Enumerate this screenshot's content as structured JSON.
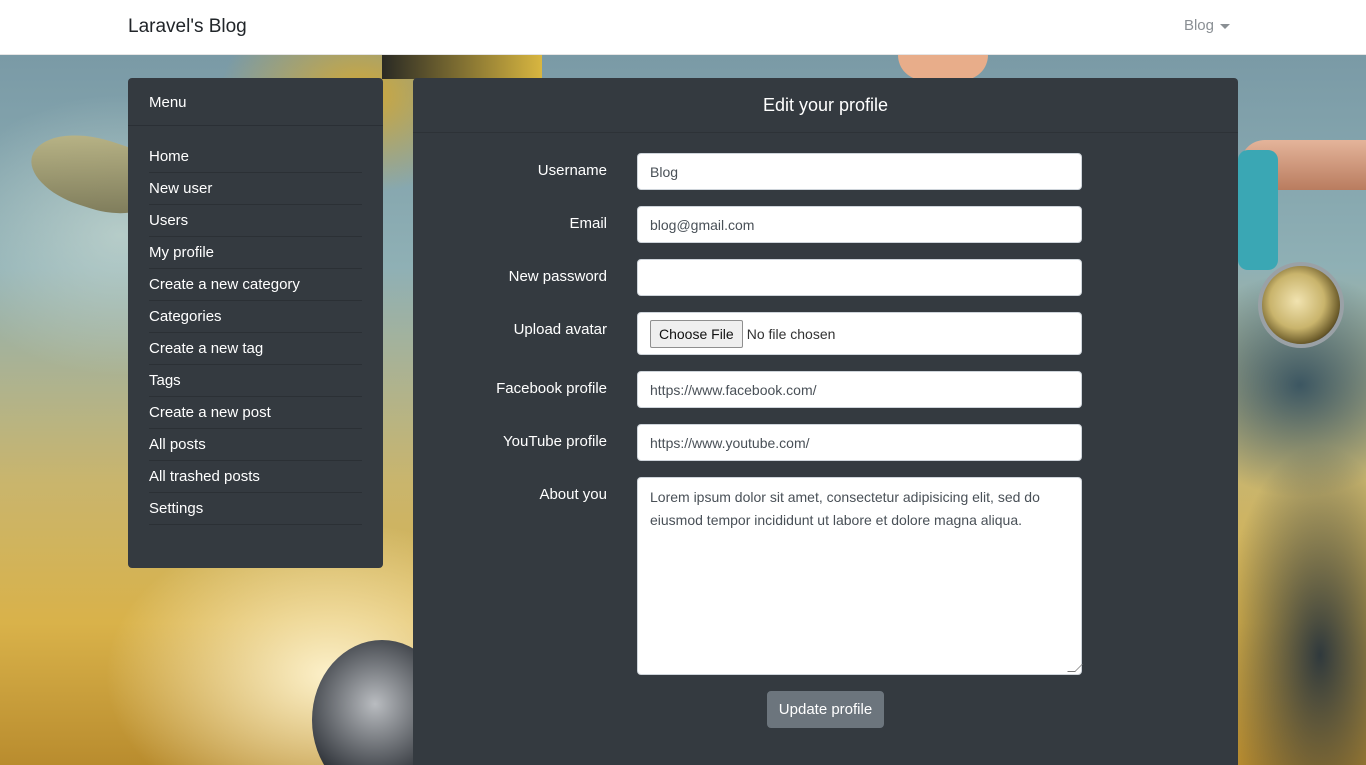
{
  "navbar": {
    "brand": "Laravel's Blog",
    "user_dropdown": "Blog"
  },
  "sidebar": {
    "title": "Menu",
    "items": [
      {
        "label": "Home"
      },
      {
        "label": "New user"
      },
      {
        "label": "Users"
      },
      {
        "label": "My profile"
      },
      {
        "label": "Create a new category"
      },
      {
        "label": "Categories"
      },
      {
        "label": "Create a new tag"
      },
      {
        "label": "Tags"
      },
      {
        "label": "Create a new post"
      },
      {
        "label": "All posts"
      },
      {
        "label": "All trashed posts"
      },
      {
        "label": "Settings"
      }
    ]
  },
  "form": {
    "title": "Edit your profile",
    "username": {
      "label": "Username",
      "value": "Blog"
    },
    "email": {
      "label": "Email",
      "value": "blog@gmail.com"
    },
    "password": {
      "label": "New password",
      "value": ""
    },
    "avatar": {
      "label": "Upload avatar",
      "button": "Choose File",
      "status": "No file chosen"
    },
    "facebook": {
      "label": "Facebook profile",
      "value": "https://www.facebook.com/"
    },
    "youtube": {
      "label": "YouTube profile",
      "value": "https://www.youtube.com/"
    },
    "about": {
      "label": "About you",
      "value": "Lorem ipsum dolor sit amet, consectetur adipisicing elit, sed do eiusmod tempor incididunt ut labore et dolore magna aliqua."
    },
    "submit_label": "Update profile"
  }
}
